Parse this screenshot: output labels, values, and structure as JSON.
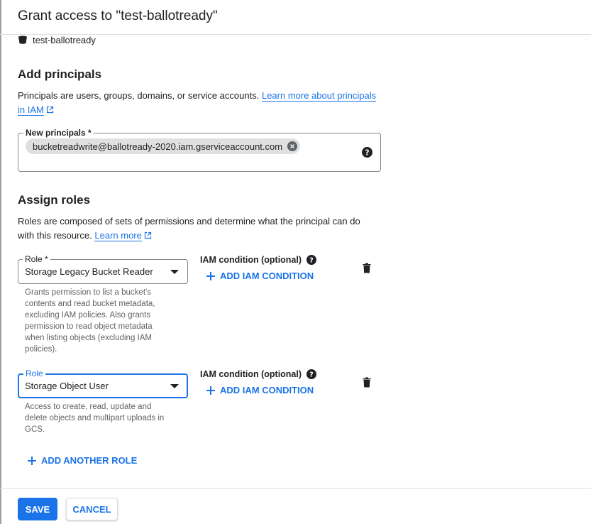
{
  "dialog": {
    "title": "Grant access to \"test-ballotready\"",
    "resource_name": "test-ballotready"
  },
  "principals": {
    "heading": "Add principals",
    "description": "Principals are users, groups, domains, or service accounts.",
    "learn_more_line1": "Learn more about principals",
    "learn_more_line2": "in IAM",
    "field_label": "New principals *",
    "chips": [
      "bucketreadwrite@ballotready-2020.iam.gserviceaccount.com"
    ]
  },
  "roles": {
    "heading": "Assign roles",
    "description_line1": "Roles are composed of sets of permissions and determine what the principal can do",
    "description_line2": "with this resource.",
    "learn_more": "Learn more",
    "items": [
      {
        "label": "Role *",
        "value": "Storage Legacy Bucket Reader",
        "helper": [
          "Grants permission to list a bucket's",
          "contents and read bucket metadata,",
          "excluding IAM policies. Also grants",
          "permission to read object metadata",
          "when listing objects (excluding IAM",
          "policies)."
        ],
        "condition_label": "IAM condition (optional)",
        "add_condition": "ADD IAM CONDITION"
      },
      {
        "label": "Role",
        "value": "Storage Object User",
        "helper": [
          "Access to create, read, update and",
          "delete objects and multipart uploads in",
          "GCS."
        ],
        "condition_label": "IAM condition (optional)",
        "add_condition": "ADD IAM CONDITION"
      }
    ],
    "add_another": "ADD ANOTHER ROLE"
  },
  "footer": {
    "save": "SAVE",
    "cancel": "CANCEL"
  },
  "icons": {
    "bucket": "bucket-icon",
    "external": "external-link-icon",
    "help": "help-icon",
    "remove_chip": "remove-chip-icon",
    "dropdown": "dropdown-caret-icon",
    "delete": "trash-icon",
    "add": "plus-icon"
  },
  "colors": {
    "accent": "#1a73e8",
    "text": "#202124",
    "muted": "#5f6368",
    "chip": "#e0e0e0"
  }
}
